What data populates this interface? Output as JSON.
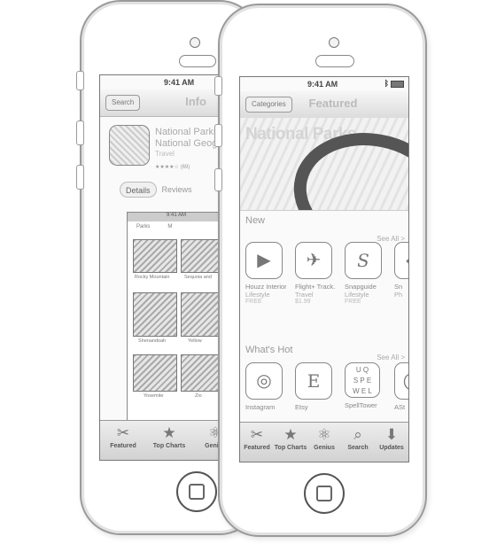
{
  "back_phone": {
    "status": {
      "time": "9:41 AM"
    },
    "nav": {
      "back_label": "Search",
      "title": "Info"
    },
    "app": {
      "name": "National Parks by National Geographic",
      "name_line1": "National Parks",
      "name_line2": "National Geogr",
      "category": "Travel",
      "rating": "★★★★☆",
      "rating_count": "(69)"
    },
    "segments": [
      "Details",
      "Reviews"
    ],
    "screenshot": {
      "time": "9:41 AM",
      "tabs": [
        "Parks",
        "M"
      ],
      "parks": [
        "Rocky Mountain",
        "Sequoia and",
        "Shenandoah",
        "Yellow",
        "Yosemite",
        "Zio"
      ]
    }
  },
  "front_phone": {
    "status": {
      "time": "9:41 AM"
    },
    "nav": {
      "left_label": "Categories",
      "title": "Featured"
    },
    "banner": {
      "title": "National Parks"
    },
    "sections": [
      {
        "title": "New",
        "see_all": "See All >",
        "apps": [
          {
            "name": "Houzz Interior...",
            "category": "Lifestyle",
            "price": "FREE",
            "icon": "houzz-icon",
            "glyph": "▶"
          },
          {
            "name": "Flight+ Track...",
            "category": "Travel",
            "price": "$1.99",
            "icon": "plane-icon",
            "glyph": "✈"
          },
          {
            "name": "Snapguide",
            "category": "Lifestyle",
            "price": "FREE",
            "icon": "snapguide-icon",
            "glyph": "S"
          },
          {
            "name": "Sn",
            "category": "Ph",
            "price": "",
            "icon": "partial-app-icon",
            "glyph": "◆"
          }
        ]
      },
      {
        "title": "What's Hot",
        "see_all": "See All >",
        "apps": [
          {
            "name": "Instagram",
            "category": "",
            "price": "",
            "icon": "instagram-icon",
            "glyph": "◎"
          },
          {
            "name": "Etsy",
            "category": "",
            "price": "",
            "icon": "etsy-icon",
            "glyph": "E"
          },
          {
            "name": "SpellTower",
            "category": "",
            "price": "",
            "icon": "spelltower-icon",
            "glyph": "U Q\nS P E\nW E L"
          },
          {
            "name": "ASt",
            "category": "",
            "price": "",
            "icon": "partial-app-icon",
            "glyph": "◯"
          }
        ]
      }
    ]
  },
  "tabbar": [
    {
      "label": "Featured",
      "icon": "featured-icon",
      "glyph": "✂"
    },
    {
      "label": "Top Charts",
      "icon": "star-icon",
      "glyph": "★"
    },
    {
      "label": "Genius",
      "icon": "genius-icon",
      "glyph": "⚛"
    },
    {
      "label": "Search",
      "icon": "search-icon",
      "glyph": "⌕"
    },
    {
      "label": "Updates",
      "icon": "updates-icon",
      "glyph": "⬇"
    }
  ],
  "colors": {
    "outline": "#8a8a8a",
    "bar": "#dcdcdc",
    "text": "#888888"
  }
}
